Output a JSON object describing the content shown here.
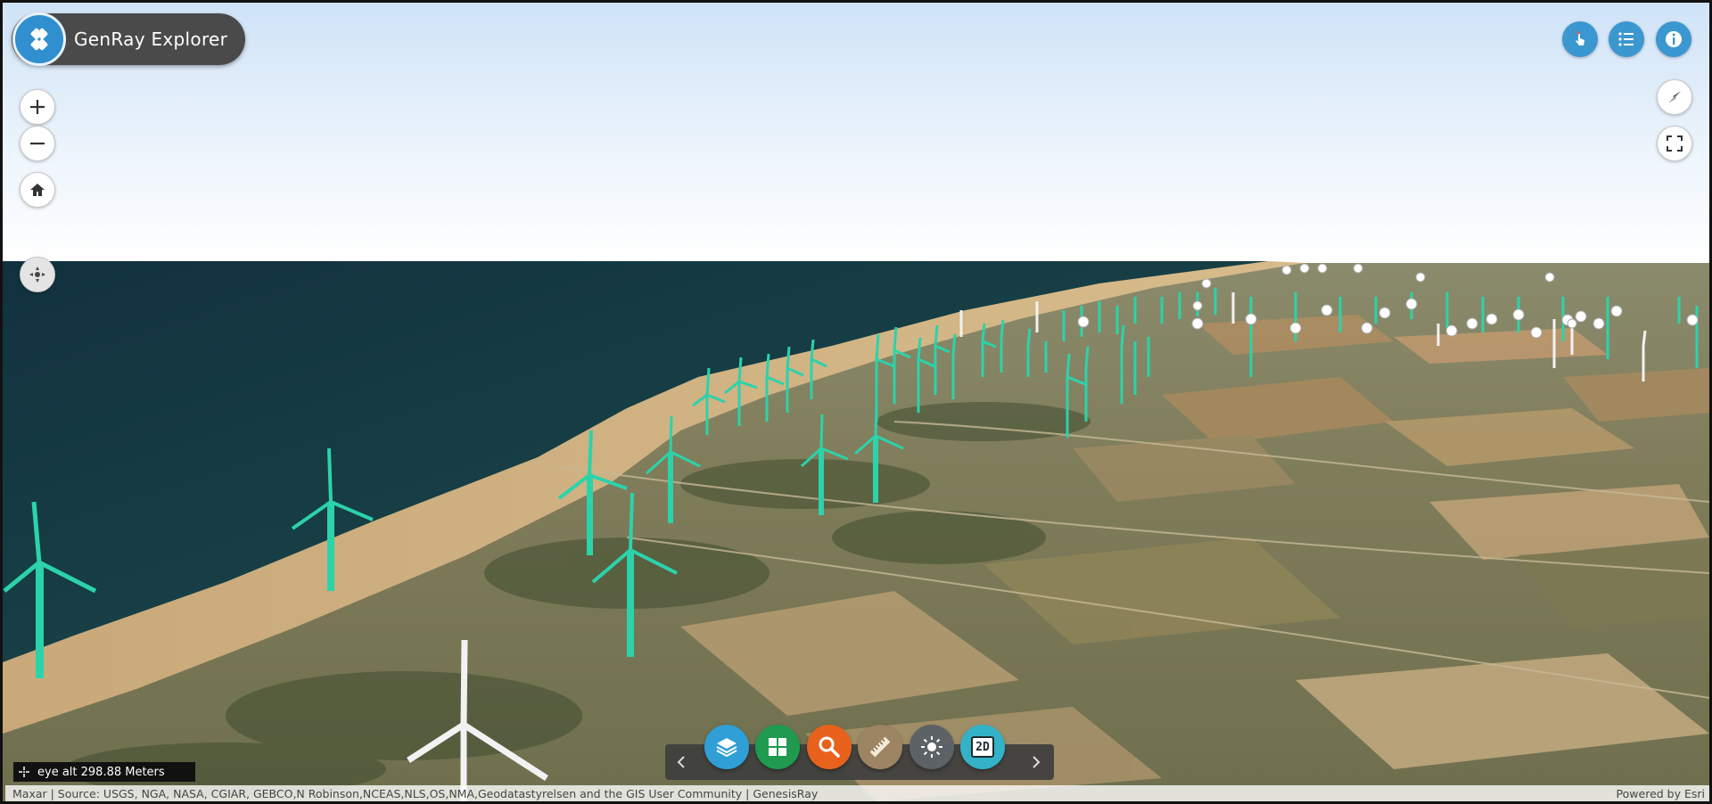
{
  "app": {
    "title": "GenRay Explorer"
  },
  "icons": {
    "logo": "diamond-logo-icon",
    "zoom_in": "plus-icon",
    "zoom_out": "minus-icon",
    "home": "home-icon",
    "navigation": "navigation-icon",
    "compass": "compass-icon",
    "fullscreen": "fullscreen-icon",
    "select": "pointer-icon",
    "legend": "list-icon",
    "about": "info-icon",
    "layers": "layers-icon",
    "basemap": "grid-icon",
    "search": "search-icon",
    "measure": "ruler-icon",
    "daylight": "sun-icon",
    "view_toggle": "2d-icon"
  },
  "toolbar": {
    "view_toggle_label": "2D"
  },
  "colors": {
    "title_bg": "#4a4a4a",
    "accent_blue": "#3b97d0",
    "layers": "#2f9fd6",
    "basemap": "#1f9a4f",
    "search": "#e8621d",
    "measure": "#9d8462",
    "daylight": "#5c6266",
    "view_toggle": "#34b2c8",
    "turbine": "#2bd3aa"
  },
  "status": {
    "eye_alt": "eye alt 298.88 Meters"
  },
  "attribution": {
    "sources": "Maxar | Source: USGS, NGA, NASA, CGIAR, GEBCO,N Robinson,NCEAS,NLS,OS,NMA,Geodatastyrelsen and the GIS User Community | GenesisRay",
    "powered_by": "Powered by Esri"
  }
}
